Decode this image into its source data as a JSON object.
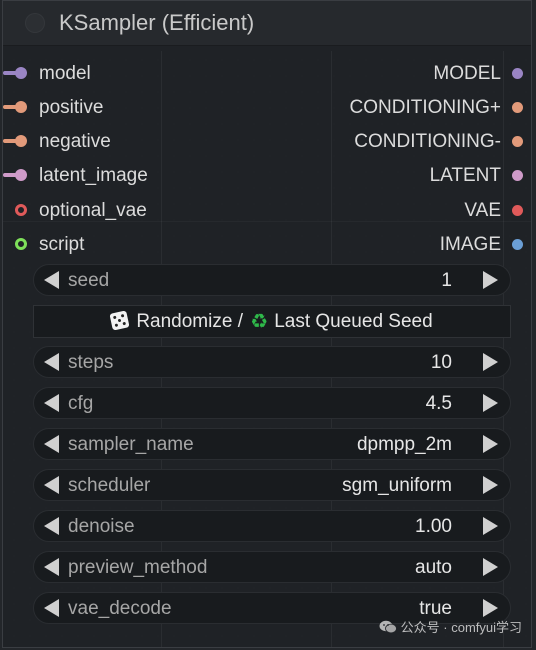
{
  "node": {
    "title": "KSampler (Efficient)",
    "inputs": [
      {
        "label": "model",
        "color": "#9a85c4",
        "style": "filled"
      },
      {
        "label": "positive",
        "color": "#e29a7a",
        "style": "filled"
      },
      {
        "label": "negative",
        "color": "#e29a7a",
        "style": "filled"
      },
      {
        "label": "latent_image",
        "color": "#cf9bc9",
        "style": "filled"
      },
      {
        "label": "optional_vae",
        "color": "#e05a5a",
        "style": "ring"
      },
      {
        "label": "script",
        "color": "#7ee05a",
        "style": "ring"
      }
    ],
    "outputs": [
      {
        "label": "MODEL",
        "color": "#9a85c4"
      },
      {
        "label": "CONDITIONING+",
        "color": "#e29a7a"
      },
      {
        "label": "CONDITIONING-",
        "color": "#e29a7a"
      },
      {
        "label": "LATENT",
        "color": "#cf9bc9"
      },
      {
        "label": "VAE",
        "color": "#e05a5a"
      },
      {
        "label": "IMAGE",
        "color": "#6b9fd6"
      }
    ],
    "widgets": {
      "seed": {
        "name": "seed",
        "value": "1"
      },
      "randomize_button": {
        "part1": "Randomize /",
        "part2": "Last Queued Seed",
        "dice_icon": "dice-icon",
        "recycle_icon": "♻"
      },
      "steps": {
        "name": "steps",
        "value": "10"
      },
      "cfg": {
        "name": "cfg",
        "value": "4.5"
      },
      "sampler_name": {
        "name": "sampler_name",
        "value": "dpmpp_2m"
      },
      "scheduler": {
        "name": "scheduler",
        "value": "sgm_uniform"
      },
      "denoise": {
        "name": "denoise",
        "value": "1.00"
      },
      "preview_method": {
        "name": "preview_method",
        "value": "auto"
      },
      "vae_decode": {
        "name": "vae_decode",
        "value": "true"
      }
    }
  },
  "watermark": {
    "text": "公众号 · comfyui学习",
    "icon": "wechat-icon"
  }
}
